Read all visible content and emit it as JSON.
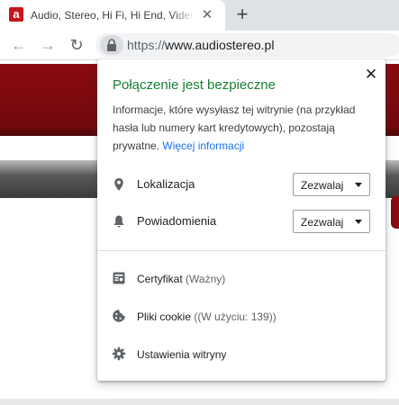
{
  "tab": {
    "favicon_letter": "a",
    "title": "Audio, Stereo, Hi Fi, Hi End, Video",
    "close_glyph": "✕",
    "new_tab_glyph": "+"
  },
  "toolbar": {
    "back_glyph": "←",
    "forward_glyph": "→",
    "reload_glyph": "↻",
    "url_scheme": "https://",
    "url_host": "www.audiostereo.pl"
  },
  "popup": {
    "title": "Połączenie jest bezpieczne",
    "close_glyph": "✕",
    "description": "Informacje, które wysyłasz tej witrynie (na przykład hasła lub numery kart kredytowych), pozostają prywatne.",
    "more_link": "Więcej informacji",
    "permissions": [
      {
        "label": "Lokalizacja",
        "value": "Zezwalaj",
        "icon": "location-pin-icon"
      },
      {
        "label": "Powiadomienia",
        "value": "Zezwalaj",
        "icon": "bell-icon"
      }
    ],
    "rows": [
      {
        "label": "Certyfikat",
        "sub": "(Ważny)",
        "icon": "certificate-icon"
      },
      {
        "label": "Pliki cookie",
        "sub": "((W użyciu: 139))",
        "icon": "cookie-icon"
      },
      {
        "label": "Ustawienia witryny",
        "sub": "",
        "icon": "gear-icon"
      }
    ]
  },
  "colors": {
    "secure_green": "#188038",
    "link_blue": "#1a73e8",
    "site_red": "#8a0b10"
  }
}
